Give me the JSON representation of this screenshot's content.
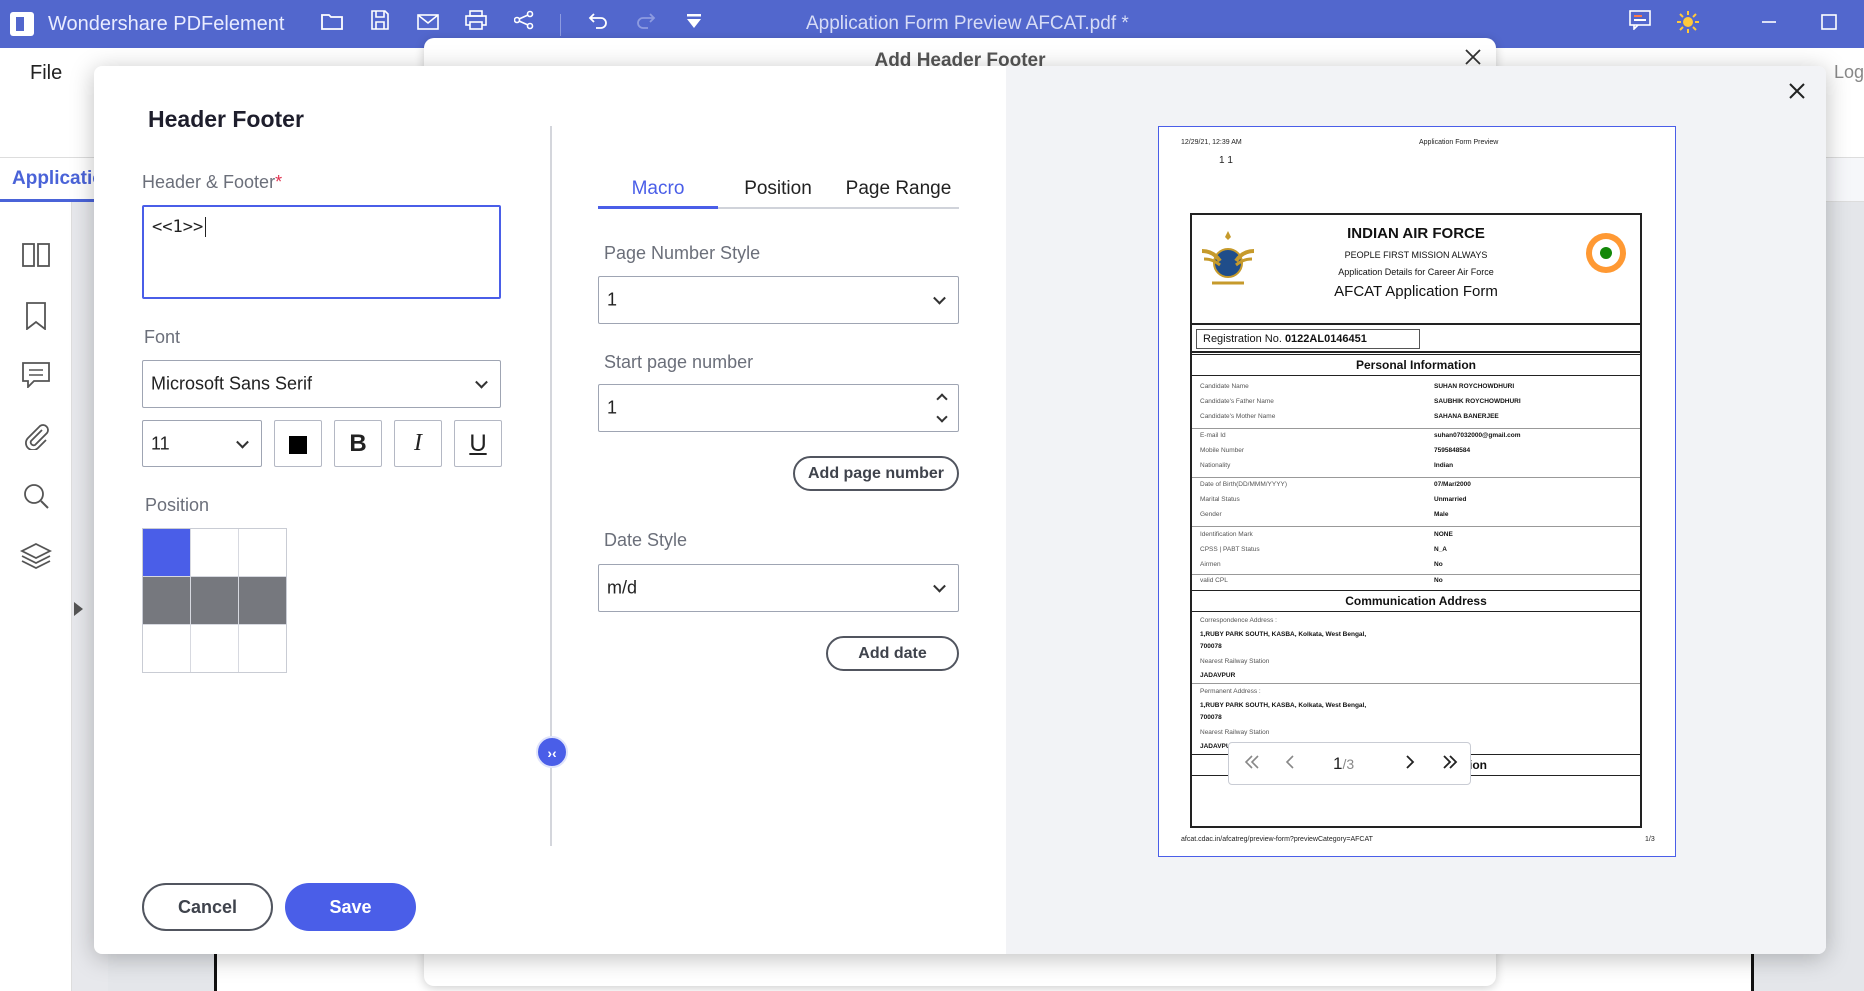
{
  "app": {
    "name": "Wondershare PDFelement",
    "document_title": "Application Form Preview AFCAT.pdf *"
  },
  "background": {
    "menu_file": "File",
    "menu_log": "Log",
    "tab_label": "Applicatio",
    "behind_dialog_title": "Add Header Footer"
  },
  "dialog": {
    "title": "Header  Footer",
    "hf_label": "Header & Footer",
    "required_mark": "*",
    "hf_value": "<<1>>",
    "font_label": "Font",
    "font_value": "Microsoft Sans Serif",
    "size_value": "11",
    "bold_label": "B",
    "italic_label": "I",
    "underline_label": "U",
    "position_label": "Position",
    "tabs": [
      "Macro",
      "Position",
      "Page Range"
    ],
    "page_number_style_label": "Page Number Style",
    "page_number_style_value": "1",
    "start_page_label": "Start page number",
    "start_page_value": "1",
    "add_page_number": "Add page number",
    "date_style_label": "Date Style",
    "date_style_value": "m/d",
    "add_date": "Add date",
    "cancel": "Cancel",
    "save": "Save",
    "collapse_glyph": "›‹"
  },
  "preview": {
    "header_left": "12/29/21, 12:39 AM",
    "header_center": "Application Form Preview",
    "page_number_stamp": "1 1",
    "form": {
      "title": "INDIAN AIR FORCE",
      "motto": "PEOPLE FIRST MISSION ALWAYS",
      "subtitle": "Application Details for Career Air Force",
      "form_name": "AFCAT Application Form",
      "reg_label": "Registration No.",
      "reg_value": "0122AL0146451",
      "personal_head": "Personal Information",
      "rows": [
        {
          "k": "Candidate Name",
          "v": "SUHAN ROYCHOWDHURI"
        },
        {
          "k": "Candidate's Father Name",
          "v": "SAUBHIK ROYCHOWDHURI"
        },
        {
          "k": "Candidate's Mother Name",
          "v": "SAHANA BANERJEE"
        },
        {
          "k": "E-mail Id",
          "v": "suhan07032000@gmail.com"
        },
        {
          "k": "Mobile Number",
          "v": "7595848584"
        },
        {
          "k": "Nationality",
          "v": "Indian"
        },
        {
          "k": "Date of Birth(DD/MMM/YYYY)",
          "v": "07/Mar/2000"
        },
        {
          "k": "Marital Status",
          "v": "Unmarried"
        },
        {
          "k": "Gender",
          "v": "Male"
        },
        {
          "k": "Identification Mark",
          "v": "NONE"
        },
        {
          "k": "CPSS | PABT Status",
          "v": "N_A"
        },
        {
          "k": "Airmen",
          "v": "No"
        },
        {
          "k": "valid CPL",
          "v": "No"
        }
      ],
      "comm_head": "Communication Address",
      "corr_label": "Correspondence Address :",
      "corr_line1": "1,RUBY PARK SOUTH, KASBA, Kolkata, West Bengal,",
      "corr_line2": "700078",
      "rail_label": "Nearest Railway Station",
      "rail_value": "JADAVPUR",
      "perm_label": "Permanent Address :",
      "perm_line1": "1,RUBY PARK SOUTH, KASBA, Kolkata, West Bengal,",
      "perm_line2": "700078",
      "rail_label2": "Nearest Railway Station",
      "rail_value2": "JADAVPUR",
      "qual_head": "Qualification Information"
    },
    "footer_left": "afcat.cdac.in/afcatreg/preview-form?previewCategory=AFCAT",
    "footer_right": "1/3",
    "pager_current": "1",
    "pager_total": "/3"
  }
}
